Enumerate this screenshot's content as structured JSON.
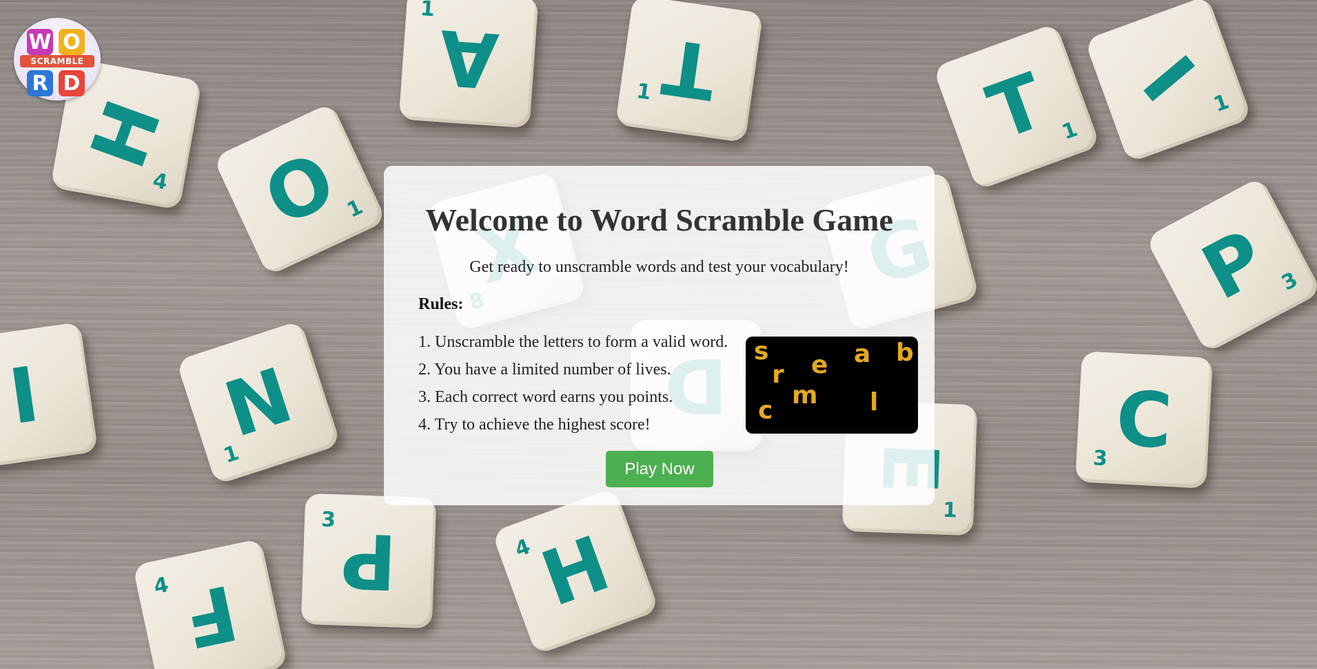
{
  "page": {
    "title": "Welcome to Word Scramble Game",
    "subtitle": "Get ready to unscramble words and test your vocabulary!",
    "rules_heading": "Rules:",
    "rules": [
      "1. Unscramble the letters to form a valid word.",
      "2. You have a limited number of lives.",
      "3. Each correct word earns you points.",
      "4. Try to achieve the highest score!"
    ],
    "play_button": "Play Now"
  },
  "logo": {
    "letters": [
      "W",
      "O",
      "R",
      "D"
    ],
    "band_text": "SCRAMBLE"
  },
  "scramble_image": {
    "letters": [
      "s",
      "e",
      "a",
      "b",
      "r",
      "m",
      "l",
      "c"
    ]
  },
  "background_tiles": {
    "letters": [
      "H",
      "O",
      "A",
      "T",
      "T",
      "I",
      "P",
      "N",
      "C",
      "P",
      "F",
      "H",
      "E",
      "G",
      "I",
      "X",
      "D"
    ],
    "numbers": [
      "4",
      "1",
      "1",
      "1",
      "1",
      "1",
      "3",
      "1",
      "3",
      "3",
      "4",
      "4",
      "1",
      "8"
    ]
  },
  "colors": {
    "accent": "#4caf50",
    "scramble_letters": "#e3a823",
    "tile_letter": "#0e8f88"
  }
}
